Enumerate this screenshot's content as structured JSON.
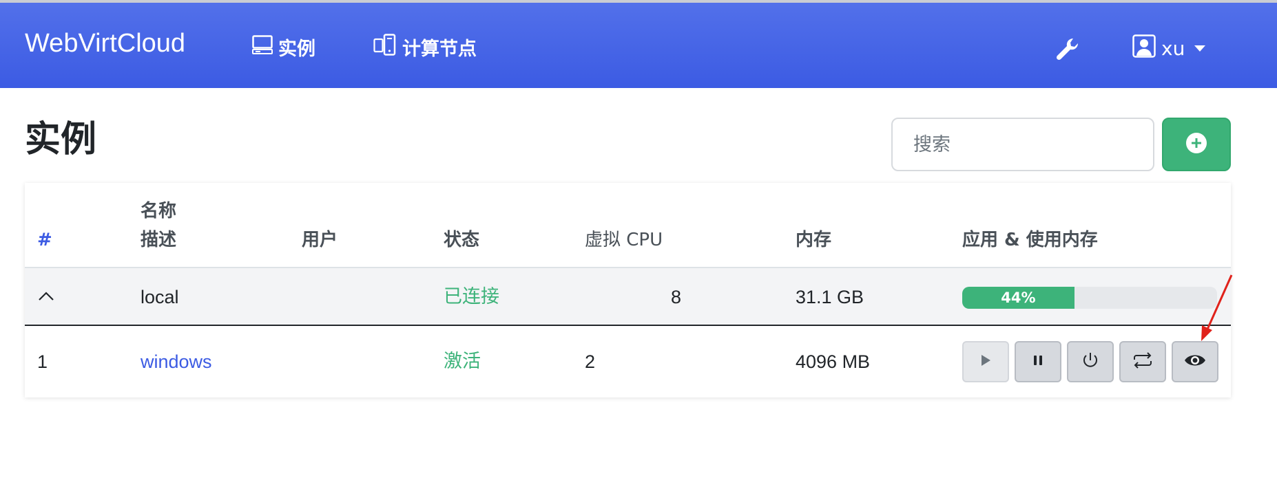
{
  "app": {
    "brand": "WebVirtCloud"
  },
  "nav": {
    "instances_label": "实例",
    "nodes_label": "计算节点",
    "user_name": "xu"
  },
  "page": {
    "title": "实例"
  },
  "search": {
    "placeholder": "搜索"
  },
  "table": {
    "headers": {
      "hash": "#",
      "name": "名称",
      "description": "描述",
      "user": "用户",
      "status": "状态",
      "vcpu": "虚拟 CPU",
      "memory": "内存",
      "usage": "应用 & 使用内存"
    },
    "group": {
      "toggle": "^",
      "name": "local",
      "status": "已连接",
      "vcpu": "8",
      "memory": "31.1 GB",
      "usage_percent": 44,
      "usage_label": "44%"
    },
    "rows": [
      {
        "index": "1",
        "name": "windows",
        "user": "",
        "status": "激活",
        "vcpu": "2",
        "memory": "4096 MB"
      }
    ]
  },
  "icons": {
    "instances": "monitor-icon",
    "nodes": "devices-icon",
    "tools": "wrench-icon",
    "user": "user-icon",
    "add": "plus-circle-icon",
    "actions": [
      "play-icon",
      "pause-icon",
      "power-icon",
      "repeat-icon",
      "eye-icon"
    ]
  },
  "colors": {
    "navbar": "#3c5be3",
    "success": "#3db37a",
    "link": "#3c5be3",
    "annotation": "#e0221b"
  }
}
